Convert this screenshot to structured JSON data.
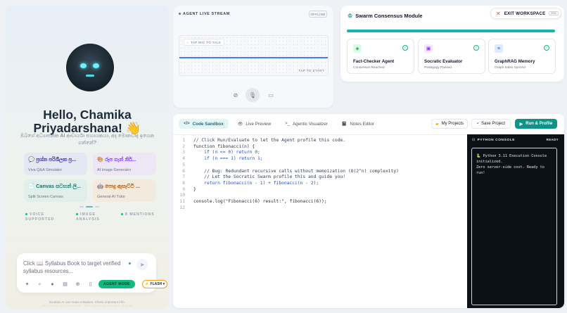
{
  "sidebar": {
    "greeting": "Hello, Chamika Priyadarshana! 👋",
    "subtitle": "ඔබගේ අධ්‍යාපනික AI ආචාර්යා සහායකයා, අද මොනවාද ඉගෙන ගන්නේ?",
    "cards": [
      {
        "title": "💬 ප්‍රශ්න පරිශීලක ප්‍ර...",
        "sub": "Viva Q&A Simulator"
      },
      {
        "title": "🎨 රූප ගැන් නිර්...",
        "sub": "AI Image Generator"
      },
      {
        "title": "📄 Canvas සටහන් ලි...",
        "sub": "Split Screen Canvas"
      },
      {
        "title": "🤖 පොදු ඇසෑට්ටි ...",
        "sub": "General AI Tutor"
      }
    ],
    "stats": [
      "VOICE SUPPORTED",
      "IMAGE ANALYSIS",
      "8 MENTIONS"
    ],
    "chat": {
      "placeholder": "Click 📖 Syllabus Book to target verified syllabus resources...",
      "send": "➤",
      "agent_mode": "AGENT MODE",
      "flash": "⚡ FLASH ▾"
    },
    "footer": "ZuuEan AI can make mistakes. Check important info.",
    "footer2": "DESIGNED BY CHAMIKA · SRI LANKA ACADEMIC MODEL"
  },
  "live": {
    "title": "AGENT LIVE STREAM",
    "status": "OFFLINE",
    "tap_mic": "TAP MIC TO TALK",
    "tap_start": "TAP TO START"
  },
  "swarm": {
    "title": "Swarm Consensus Module",
    "agents": [
      {
        "name": "Fact-Checker Agent",
        "status": "Consensus Reached"
      },
      {
        "name": "Socratic Evaluator",
        "status": "Pedagogy Passed"
      },
      {
        "name": "GraphRAG Memory",
        "status": "Graph Index Synced"
      }
    ]
  },
  "exit": {
    "label": "EXIT WORKSPACE",
    "key": "ESC"
  },
  "ide": {
    "tabs": [
      {
        "icon": "</>",
        "label": "Code Sandbox"
      },
      {
        "icon": "👁",
        "label": "Live Preview"
      },
      {
        "icon": ">_",
        "label": "Agentic Visualizer"
      },
      {
        "icon": "📓",
        "label": "Notes Editor"
      }
    ],
    "my_projects": "My Projects",
    "save_project": "Save Project",
    "run": "Run & Profile",
    "code": [
      "// Click Run/Evaluate to let the Agent profile this code.",
      "function fibonacci(n) {",
      "    if (n <= 0) return 0;",
      "    if (n === 1) return 1;",
      "",
      "    // Bug: Redundant recursive calls without memoization (O(2^n) complexity)",
      "    // Let the Socratic Swarm profile this and guide you!",
      "    return fibonacci(n - 1) + fibonacci(n - 2);",
      "}",
      "",
      "console.log(\"Fibonacci(6) result:\", fibonacci(6));",
      ""
    ],
    "console": {
      "title": "PYTHON CONSOLE",
      "status": "READY",
      "lines": [
        "🐍 Python 3.11 Execution Console initialized.",
        "Zero server-side cost. Ready to run!"
      ]
    }
  },
  "colors": {
    "accent": "#0d9488",
    "agent_mode": "#10b981",
    "wave": "#3b82f6",
    "console_bg": "#0b1116"
  }
}
